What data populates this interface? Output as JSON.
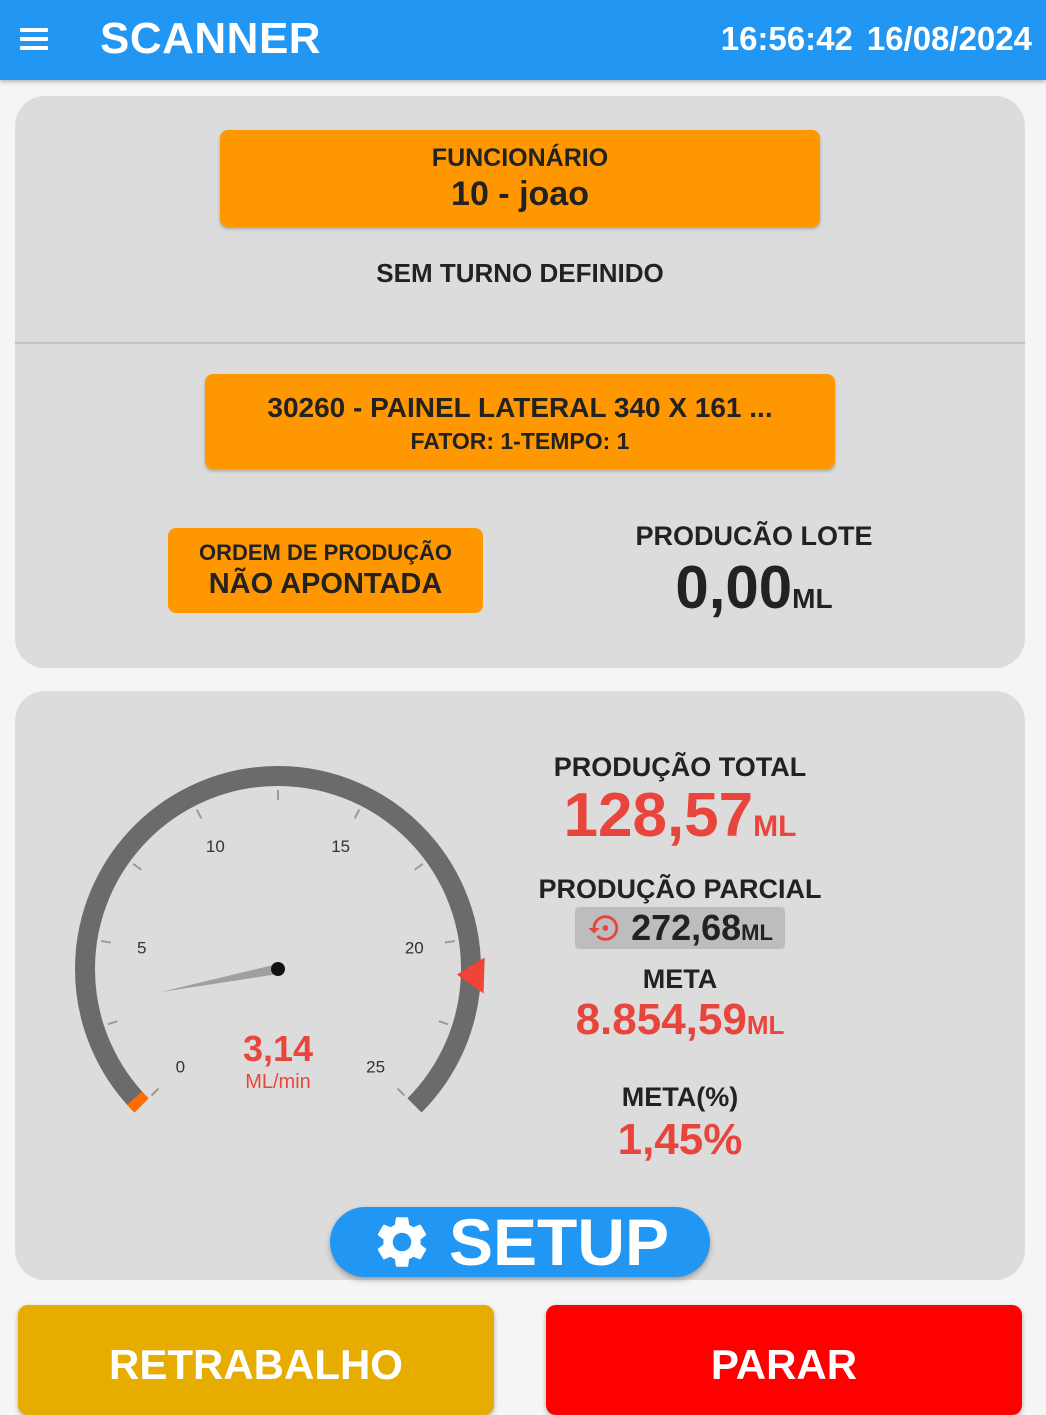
{
  "appbar": {
    "title": "SCANNER",
    "time": "16:56:42",
    "date": "16/08/2024",
    "menu_icon": "menu-icon"
  },
  "employee": {
    "label": "FUNCIONÁRIO",
    "value": "10 - joao"
  },
  "shift_text": "SEM TURNO DEFINIDO",
  "product": {
    "name": "30260  - PAINEL  LATERAL  340  X 161 ...",
    "factor": "FATOR: 1-TEMPO: 1"
  },
  "order": {
    "label": "ORDEM DE PRODUÇÃO",
    "value": "NÃO APONTADA"
  },
  "lot": {
    "label": "PRODUCÃO LOTE",
    "value": "0,00",
    "unit": "ML"
  },
  "gauge": {
    "value": 3.14,
    "value_text": "3,14",
    "unit": "ML/min",
    "min": 0,
    "max": 25,
    "ticks": [
      "0",
      "5",
      "10",
      "15",
      "20",
      "25"
    ],
    "target_marker": 21,
    "colors": {
      "track": "#6b6b6b",
      "needle": "#a0a0a0",
      "target": "#f04438",
      "value": "#e8463c",
      "start": "#ff6d00"
    }
  },
  "stats": {
    "total_label": "PRODUÇÃO TOTAL",
    "total_value": "128,57",
    "total_unit": "ML",
    "partial_label": "PRODUÇÃO PARCIAL",
    "partial_value": "272,68",
    "partial_unit": "ML",
    "partial_icon": "history-reset-icon",
    "meta_label": "META",
    "meta_value": "8.854,59",
    "meta_unit": "ML",
    "meta_pct_label": "META(%)",
    "meta_pct_value": "1,45%"
  },
  "setup_button": {
    "label": "SETUP",
    "icon": "gear-icon"
  },
  "actions": {
    "rework_label": "RETRABALHO",
    "stop_label": "PARAR"
  },
  "colors": {
    "primary": "#2196f3",
    "orange": "#ff9800",
    "red": "#e8463c",
    "rework": "#e6ac00",
    "stop": "#ff0000"
  }
}
